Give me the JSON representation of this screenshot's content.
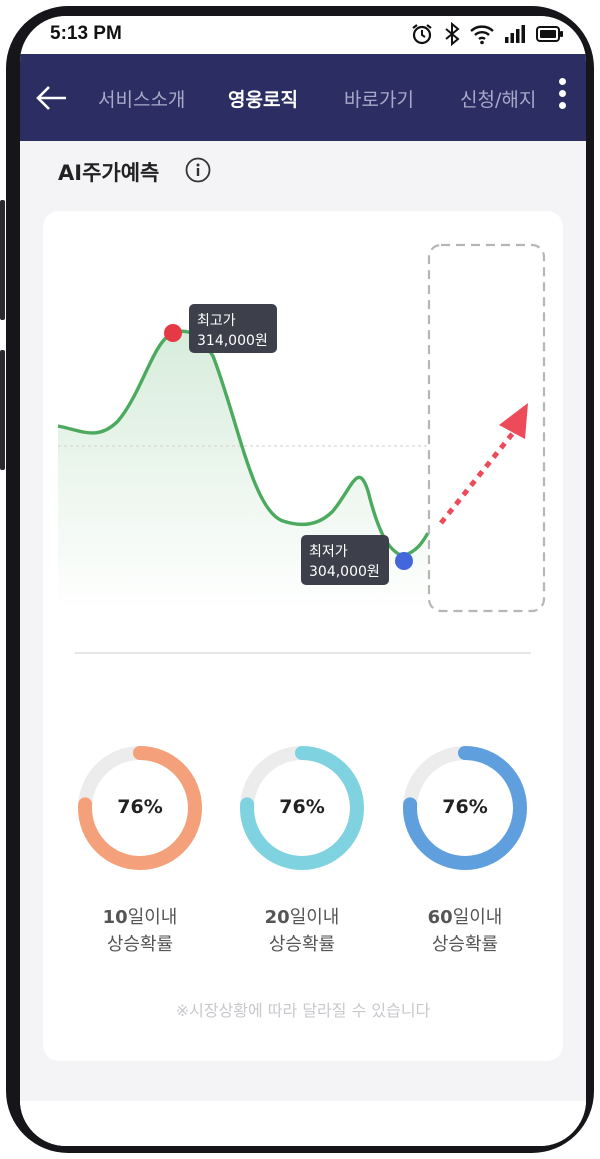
{
  "status_bar": {
    "time": "5:13 PM",
    "icons": [
      "alarm-icon",
      "bluetooth-icon",
      "wifi-icon",
      "signal-icon",
      "battery-icon"
    ]
  },
  "nav": {
    "tabs": [
      {
        "label": "서비스소개",
        "active": false
      },
      {
        "label": "영웅로직",
        "active": true
      },
      {
        "label": "바로가기",
        "active": false
      },
      {
        "label": "신청/해지",
        "active": false
      }
    ],
    "bar_color": "#2c2e63"
  },
  "section": {
    "title": "AI주가예측"
  },
  "price_chart": {
    "high": {
      "label": "최고가",
      "value": "314,000원",
      "marker_color": "#e63946"
    },
    "low": {
      "label": "최저가",
      "value": "304,000원",
      "marker_color": "#4466dd"
    },
    "line_color": "#4caa5e",
    "forecast_arrow_color": "#ee4b5a"
  },
  "probabilities": [
    {
      "percent": "76%",
      "value": 0.76,
      "days": "10",
      "suffix": "일이내",
      "caption": "상승확률",
      "color": "#f4a07a"
    },
    {
      "percent": "76%",
      "value": 0.76,
      "days": "20",
      "suffix": "일이내",
      "caption": "상승확률",
      "color": "#7fd3e0"
    },
    {
      "percent": "76%",
      "value": 0.76,
      "days": "60",
      "suffix": "일이내",
      "caption": "상승확률",
      "color": "#5f9fdd"
    }
  ],
  "disclaimer": "※시장상황에 따라 달라질 수 있습니다"
}
